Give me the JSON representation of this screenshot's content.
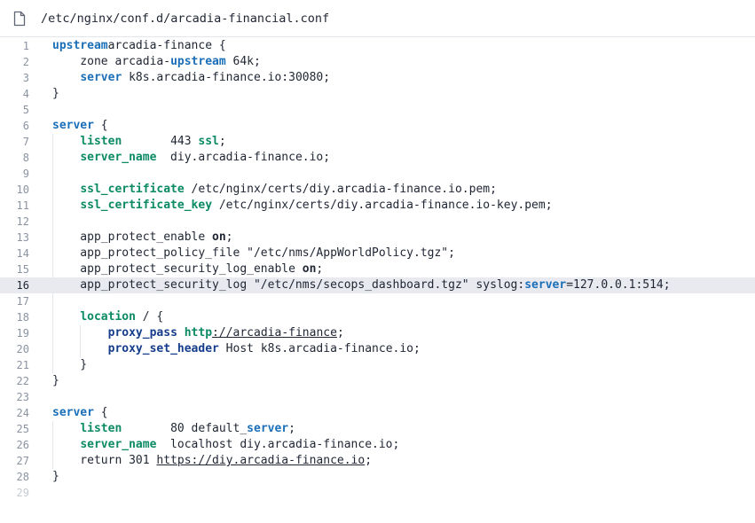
{
  "header": {
    "file_path": "/etc/nginx/conf.d/arcadia-financial.conf",
    "file_icon": "file-icon"
  },
  "editor": {
    "active_line": 16,
    "lines": [
      {
        "n": "1",
        "tokens": [
          [
            "kw",
            "upstream"
          ],
          [
            "",
            "arcadia-finance {"
          ]
        ]
      },
      {
        "n": "2",
        "tokens": [
          [
            "",
            "    zone arcadia-"
          ],
          [
            "kw",
            "upstream"
          ],
          [
            "",
            " 64k;"
          ]
        ]
      },
      {
        "n": "3",
        "tokens": [
          [
            "",
            "    "
          ],
          [
            "kw",
            "server"
          ],
          [
            "",
            " k8s.arcadia-finance.io:30080;"
          ]
        ]
      },
      {
        "n": "4",
        "tokens": [
          [
            "",
            "}"
          ]
        ]
      },
      {
        "n": "5",
        "tokens": []
      },
      {
        "n": "6",
        "tokens": [
          [
            "kw",
            "server"
          ],
          [
            "",
            " {"
          ]
        ]
      },
      {
        "n": "7",
        "tokens": [
          [
            "",
            "    "
          ],
          [
            "dir",
            "listen"
          ],
          [
            "",
            "       443 "
          ],
          [
            "dir",
            "ssl"
          ],
          [
            "",
            ";"
          ]
        ]
      },
      {
        "n": "8",
        "tokens": [
          [
            "",
            "    "
          ],
          [
            "dir",
            "server_name"
          ],
          [
            "",
            "  diy.arcadia-finance.io;"
          ]
        ]
      },
      {
        "n": "9",
        "tokens": []
      },
      {
        "n": "10",
        "tokens": [
          [
            "",
            "    "
          ],
          [
            "dir",
            "ssl_certificate"
          ],
          [
            "",
            " /etc/nginx/certs/diy.arcadia-finance.io.pem;"
          ]
        ]
      },
      {
        "n": "11",
        "tokens": [
          [
            "",
            "    "
          ],
          [
            "dir",
            "ssl_certificate_key"
          ],
          [
            "",
            " /etc/nginx/certs/diy.arcadia-finance.io-key.pem;"
          ]
        ]
      },
      {
        "n": "12",
        "tokens": []
      },
      {
        "n": "13",
        "tokens": [
          [
            "",
            "    app_protect_enable "
          ],
          [
            "bold",
            "on"
          ],
          [
            "",
            ";"
          ]
        ]
      },
      {
        "n": "14",
        "tokens": [
          [
            "",
            "    app_protect_policy_file \"/etc/nms/AppWorldPolicy.tgz\";"
          ]
        ]
      },
      {
        "n": "15",
        "tokens": [
          [
            "",
            "    app_protect_security_log_enable "
          ],
          [
            "bold",
            "on"
          ],
          [
            "",
            ";"
          ]
        ]
      },
      {
        "n": "16",
        "tokens": [
          [
            "",
            "    app_protect_security_log \"/etc/nms/secops_dashboard.tgz\" syslog:"
          ],
          [
            "kw",
            "server"
          ],
          [
            "",
            "=127.0.0.1:514;"
          ]
        ]
      },
      {
        "n": "17",
        "tokens": []
      },
      {
        "n": "18",
        "tokens": [
          [
            "",
            "    "
          ],
          [
            "dir",
            "location"
          ],
          [
            "",
            " / {"
          ]
        ]
      },
      {
        "n": "19",
        "tokens": [
          [
            "",
            "        "
          ],
          [
            "nav",
            "proxy_pass"
          ],
          [
            "",
            " "
          ],
          [
            "url-proto",
            "http"
          ],
          [
            "url",
            "://arcadia-finance"
          ],
          [
            "",
            ";"
          ]
        ]
      },
      {
        "n": "20",
        "tokens": [
          [
            "",
            "        "
          ],
          [
            "nav",
            "proxy_set_header"
          ],
          [
            "",
            " Host k8s.arcadia-finance.io;"
          ]
        ]
      },
      {
        "n": "21",
        "tokens": [
          [
            "",
            "    }"
          ]
        ]
      },
      {
        "n": "22",
        "tokens": [
          [
            "",
            "}"
          ]
        ]
      },
      {
        "n": "23",
        "tokens": []
      },
      {
        "n": "24",
        "tokens": [
          [
            "kw",
            "server"
          ],
          [
            "",
            " {"
          ]
        ]
      },
      {
        "n": "25",
        "tokens": [
          [
            "",
            "    "
          ],
          [
            "dir",
            "listen"
          ],
          [
            "",
            "       80 default_"
          ],
          [
            "kw",
            "server"
          ],
          [
            "",
            ";"
          ]
        ]
      },
      {
        "n": "26",
        "tokens": [
          [
            "",
            "    "
          ],
          [
            "dir",
            "server_name"
          ],
          [
            "",
            "  localhost diy.arcadia-finance.io;"
          ]
        ]
      },
      {
        "n": "27",
        "tokens": [
          [
            "",
            "    return 301 "
          ],
          [
            "url",
            "https://diy.arcadia-finance.io"
          ],
          [
            "",
            ";"
          ]
        ]
      },
      {
        "n": "28",
        "tokens": [
          [
            "",
            "}"
          ]
        ]
      },
      {
        "n": "29",
        "tokens": [],
        "faded": true
      }
    ]
  }
}
